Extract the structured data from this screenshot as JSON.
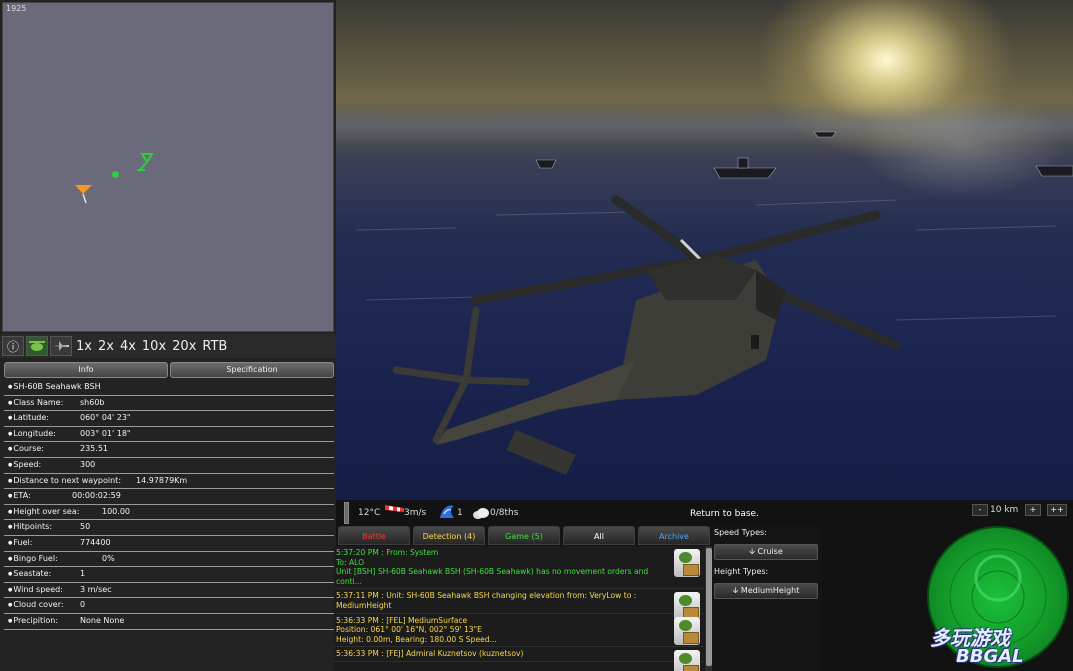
{
  "map": {
    "counter": "1925"
  },
  "toolbar": {
    "icons": [
      "info-icon",
      "helicopter-icon",
      "aircraft-icon"
    ],
    "zoom": [
      "1x",
      "2x",
      "4x",
      "10x",
      "20x",
      "RTB"
    ]
  },
  "info_tabs": [
    "Info",
    "Specification"
  ],
  "info": [
    {
      "label": "SH-60B Seahawk BSH",
      "value": ""
    },
    {
      "label": "Class Name:",
      "value": "sh60b"
    },
    {
      "label": "Latitude:",
      "value": "060° 04' 23\""
    },
    {
      "label": "Longitude:",
      "value": "003° 01' 18\""
    },
    {
      "label": "Course:",
      "value": "235.51"
    },
    {
      "label": "Speed:",
      "value": "300"
    },
    {
      "label": "Distance to next waypoint:",
      "value": "14.97879Km"
    },
    {
      "label": "ETA:",
      "value": "00:00:02:59"
    },
    {
      "label": "Height over sea:",
      "value": "100.00"
    },
    {
      "label": "Hitpoints:",
      "value": "50"
    },
    {
      "label": "Fuel:",
      "value": "774400"
    },
    {
      "label": "Bingo Fuel:",
      "value": "0%"
    },
    {
      "label": "Seastate:",
      "value": "1"
    },
    {
      "label": "Wind speed:",
      "value": "3 m/sec"
    },
    {
      "label": "Cloud cover:",
      "value": "0"
    },
    {
      "label": "Precipition:",
      "value": "None None"
    }
  ],
  "status": {
    "temperature": "12°C",
    "wind": "3m/s",
    "seastate": "1",
    "clouds": "0/8ths",
    "message": "Return to base.",
    "scale_minus": "-",
    "scale": "10 km",
    "scale_plus": "+",
    "scale_plusplus": "++"
  },
  "msg_tabs": [
    {
      "label": "Battle",
      "color": "#ff3030"
    },
    {
      "label": "Detection (4)",
      "color": "#f6d84b"
    },
    {
      "label": "Game (5)",
      "color": "#3ee03e"
    },
    {
      "label": "All",
      "color": "#ffffff"
    },
    {
      "label": "Archive",
      "color": "#4aa8ff"
    }
  ],
  "messages": [
    {
      "color": "green",
      "lines": [
        "5:37:20 PM : From: System",
        "To: ALO",
        "Unit [BSH] SH-60B Seahawk BSH (SH-60B Seahawk) has no movement orders and",
        "conti..."
      ]
    },
    {
      "color": "yellow",
      "lines": [
        "5:37:11 PM : Unit: SH-60B Seahawk BSH changing elevation from: VeryLow to :",
        "MediumHeight"
      ]
    },
    {
      "color": "yellow",
      "lines": [
        "5:36:33 PM : [FEL] MediumSurface",
        "Position: 061° 00' 16\"N, 002° 59' 13\"E",
        "Height: 0.00m,  Bearing: 180.00 S  Speed..."
      ]
    },
    {
      "color": "yellow",
      "lines": [
        "5:36:33 PM : [FEJ] Admiral Kuznetsov (kuznetsov)"
      ]
    }
  ],
  "orders": {
    "speed_label": "Speed Types:",
    "speed_value": "Cruise",
    "height_label": "Height Types:",
    "height_value": "MediumHeight"
  },
  "watermark": {
    "cn": "多玩游戏",
    "en": "BBGAL"
  }
}
